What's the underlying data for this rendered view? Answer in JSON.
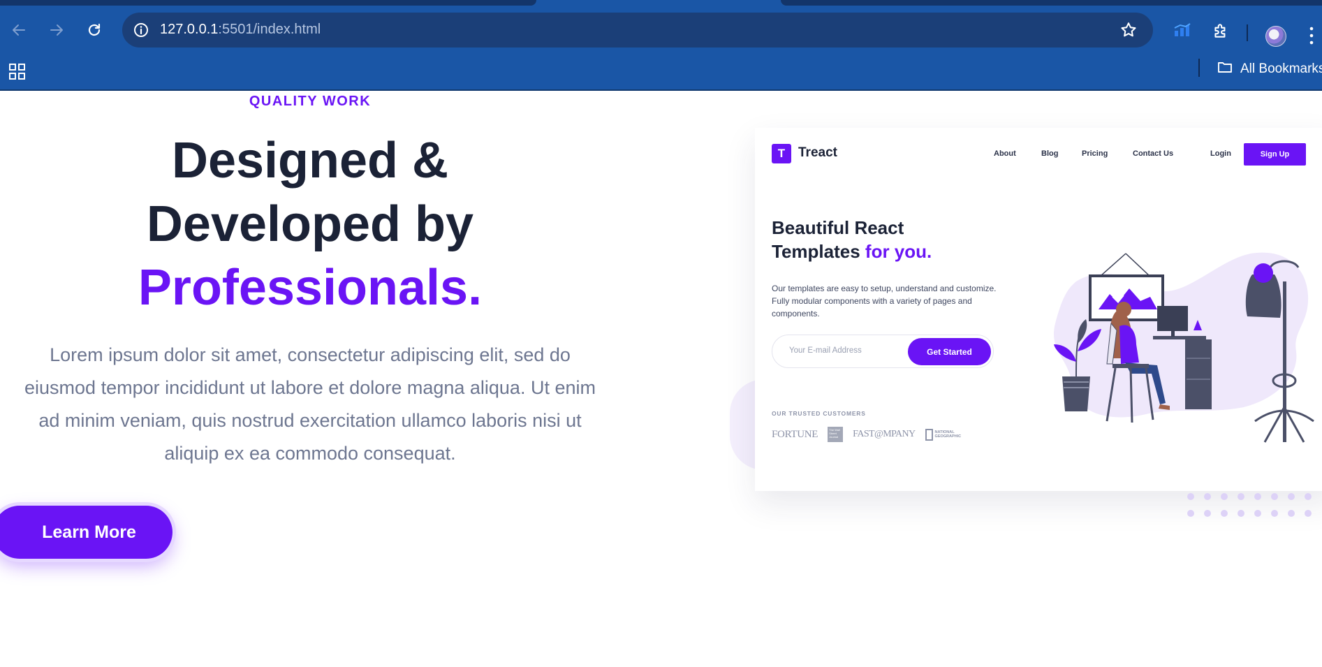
{
  "browser": {
    "url_host": "127.0.0.1",
    "url_rest": ":5501/index.html",
    "bookmarks_label": "All Bookmarks"
  },
  "hero": {
    "eyebrow": "QUALITY WORK",
    "title_line1": "Designed &",
    "title_line2": "Developed by",
    "title_accent": "Professionals.",
    "lead": "Lorem ipsum dolor sit amet, consectetur adipiscing elit, sed do eiusmod tempor incididunt ut labore et dolore magna aliqua. Ut enim ad minim veniam, quis nostrud exercitation ullamco laboris nisi ut aliquip ex ea commodo consequat.",
    "cta": "Learn More"
  },
  "mockup": {
    "logo_letter": "T",
    "brand": "Treact",
    "nav": [
      "About",
      "Blog",
      "Pricing",
      "Contact Us"
    ],
    "login": "Login",
    "signup": "Sign Up",
    "heading": "Beautiful React Templates",
    "heading_accent": "for you.",
    "description": "Our templates are easy to setup, understand and customize. Fully modular components with a variety of pages and components.",
    "email_placeholder": "Your E-mail Address",
    "get_started": "Get Started",
    "trusted_label": "OUR TRUSTED CUSTOMERS",
    "logos": {
      "fortune": "FORTUNE",
      "wsj": "The Wall Street Journal",
      "fastco": "FAST@MPANY",
      "natgeo": "NATIONAL GEOGRAPHIC"
    }
  },
  "colors": {
    "accent": "#6a14f5",
    "heading": "#1b2236",
    "body_text": "#6d7690",
    "chrome": "#1a56a6"
  },
  "icons": [
    "back-icon",
    "forward-icon",
    "reload-icon",
    "site-info-icon",
    "star-icon",
    "extension-metrics-icon",
    "puzzle-icon",
    "profile-avatar",
    "more-icon",
    "apps-icon",
    "folder-icon"
  ]
}
